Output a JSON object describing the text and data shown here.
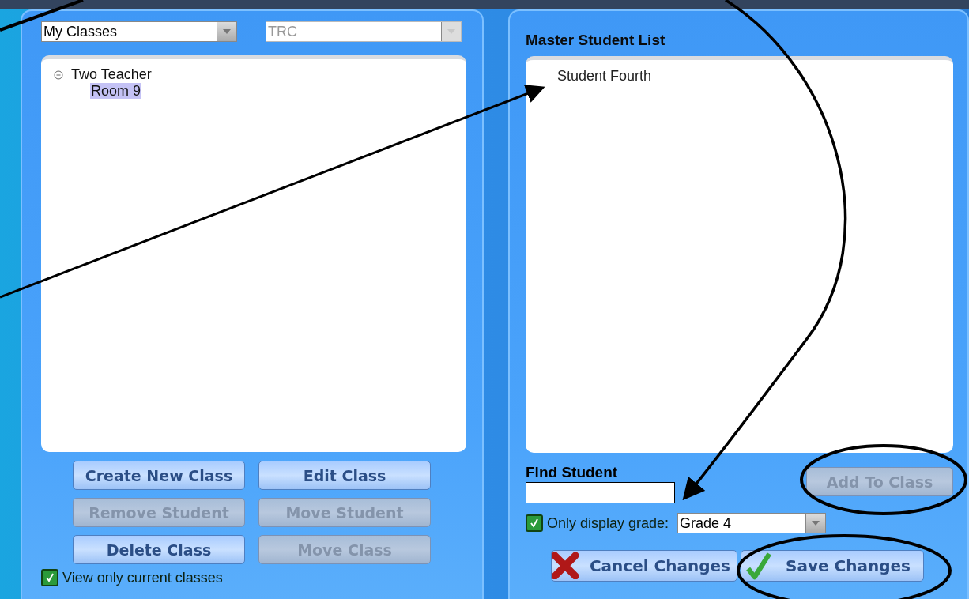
{
  "class_selector": {
    "value": "My Classes",
    "disabled": false
  },
  "teacher_selector": {
    "value": "TRC",
    "disabled": true
  },
  "class_tree": [
    {
      "label": "Two Teacher",
      "expanded": true,
      "selected": false,
      "children": [
        {
          "label": "Room 9",
          "selected": true
        }
      ]
    }
  ],
  "class_buttons": [
    {
      "label": "Create New Class",
      "disabled": false
    },
    {
      "label": "Edit Class",
      "disabled": false
    },
    {
      "label": "Remove Student",
      "disabled": true
    },
    {
      "label": "Move Student",
      "disabled": true
    },
    {
      "label": "Delete Class",
      "disabled": false
    },
    {
      "label": "Move Class",
      "disabled": true
    }
  ],
  "view_current": {
    "label": "View only current classes",
    "checked": true
  },
  "master_list": {
    "title": "Master Student List",
    "students": [
      {
        "name": "Student Fourth",
        "selected": false
      }
    ]
  },
  "find_student": {
    "label": "Find Student"
  },
  "add_button": {
    "label": "Add To Class",
    "disabled": true
  },
  "grade_filter": {
    "label": "Only display grade:",
    "checked": true,
    "value": "Grade 4"
  },
  "action_buttons": [
    {
      "label": "Cancel Changes",
      "kind": "cancel"
    },
    {
      "label": "Save Changes",
      "kind": "save"
    }
  ]
}
